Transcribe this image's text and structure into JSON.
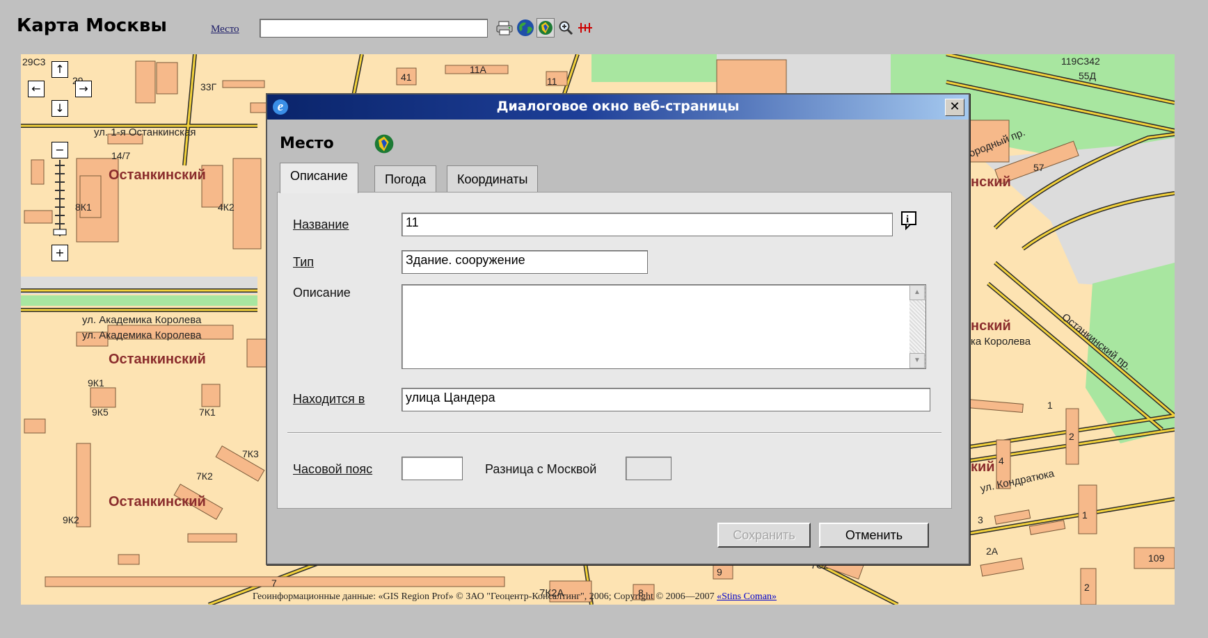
{
  "header": {
    "title": "Карта Москвы",
    "place_link": "Место",
    "place_value": "",
    "tools": [
      "printer-icon",
      "globe-icon",
      "place-info-icon",
      "zoom-icon",
      "measure-icon"
    ]
  },
  "map": {
    "labels": {
      "house_29c3": "29С3",
      "house_29": "29",
      "house_33g": "33Г",
      "house_41": "41",
      "house_11a": "11А",
      "house_11": "11",
      "house_119c342": "119С342",
      "house_55d": "55Д",
      "street_1_ostankinskaya": "ул. 1-я Останкинская",
      "house_14_7": "14/7",
      "district_1": "Останкинский",
      "house_8k1": "8К1",
      "house_4k2": "4К2",
      "street_korolev_1": "ул. Академика Королева",
      "street_korolev_2": "ул. Академика Королева",
      "district_2": "Останкинский",
      "house_9k1": "9К1",
      "house_9k5": "9К5",
      "house_7k1": "7К1",
      "house_7k3": "7К3",
      "house_7k2": "7К2",
      "district_3": "Останкинский",
      "house_9k2": "9К2",
      "house_7": "7",
      "house_7k2a": "7К2А",
      "house_8": "8",
      "house_9": "9",
      "house_7c2": "7С2",
      "house_57": "57",
      "right_district_1": "нский",
      "right_district_2": "нский",
      "right_street_korolev": "ка Королева",
      "right_street_proezd": "Останкинский пр.",
      "right_street_top": "городный пр.",
      "right_district_3": "кий",
      "house_4": "4",
      "street_kondratyuka": "ул. Кондратюка",
      "house_1a": "1",
      "house_2a": "2",
      "house_3": "3",
      "house_1b": "1",
      "house_2a_big": "2А",
      "house_109": "109",
      "house_2b": "2"
    },
    "copyright_text": "Геоинформационные данные: «GIS Region Prof» © ЗАО \"Геоцентр-Консалтинг\", 2006; Copyright © 2006—2007",
    "copyright_link": "«Stins Coman»"
  },
  "nav": {
    "up": "↑",
    "left": "←",
    "right": "→",
    "down": "↓",
    "zoom_out": "−",
    "zoom_in": "+"
  },
  "dialog": {
    "window_title": "Диалоговое окно веб-страницы",
    "close_label": "✕",
    "heading": "Место",
    "tabs": [
      {
        "label": "Описание",
        "active": true
      },
      {
        "label": "Погода",
        "active": false
      },
      {
        "label": "Координаты",
        "active": false
      }
    ],
    "form": {
      "name_label": "Название",
      "name_value": "11",
      "type_label": "Тип",
      "type_value": "Здание. сооружение",
      "description_label": "Описание",
      "description_value": "",
      "located_in_label": "Находится в",
      "located_in_value": "улица Цандера",
      "timezone_label": "Часовой пояс",
      "timezone_value": "",
      "diff_label": "Разница с Москвой",
      "diff_value": ""
    },
    "buttons": {
      "save": "Сохранить",
      "cancel": "Отменить"
    }
  }
}
